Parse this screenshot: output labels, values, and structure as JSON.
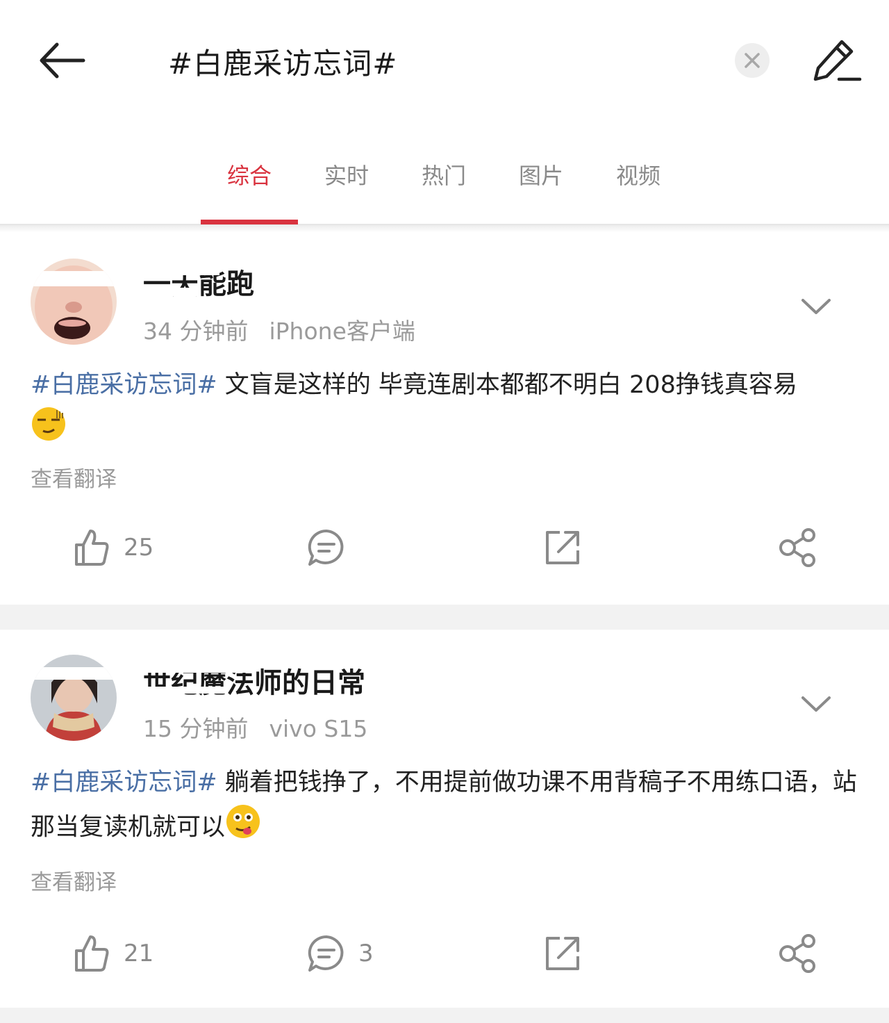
{
  "header": {
    "title": "#白鹿采访忘词#"
  },
  "tabs": [
    {
      "label": "综合",
      "active": true
    },
    {
      "label": "实时",
      "active": false
    },
    {
      "label": "热门",
      "active": false
    },
    {
      "label": "图片",
      "active": false
    },
    {
      "label": "视频",
      "active": false
    }
  ],
  "posts": [
    {
      "username": "一天能跑",
      "time": "34 分钟前",
      "device": "iPhone客户端",
      "hashtag": "#白鹿采访忘词#",
      "text": " 文盲是这样的 毕竟连剧本都都不明白 208挣钱真容易",
      "translate_label": "查看翻译",
      "likes": "25",
      "comments": ""
    },
    {
      "username": "世纪魔法师的日常",
      "time": "15 分钟前",
      "device": "vivo S15",
      "hashtag": "#白鹿采访忘词#",
      "text": " 躺着把钱挣了，不用提前做功课不用背稿子不用练口语，站那当复读机就可以",
      "translate_label": "查看翻译",
      "likes": "21",
      "comments": "3"
    }
  ],
  "colors": {
    "accent": "#d9333f",
    "hashtag": "#4a6fa5",
    "muted": "#9a9a9a"
  }
}
